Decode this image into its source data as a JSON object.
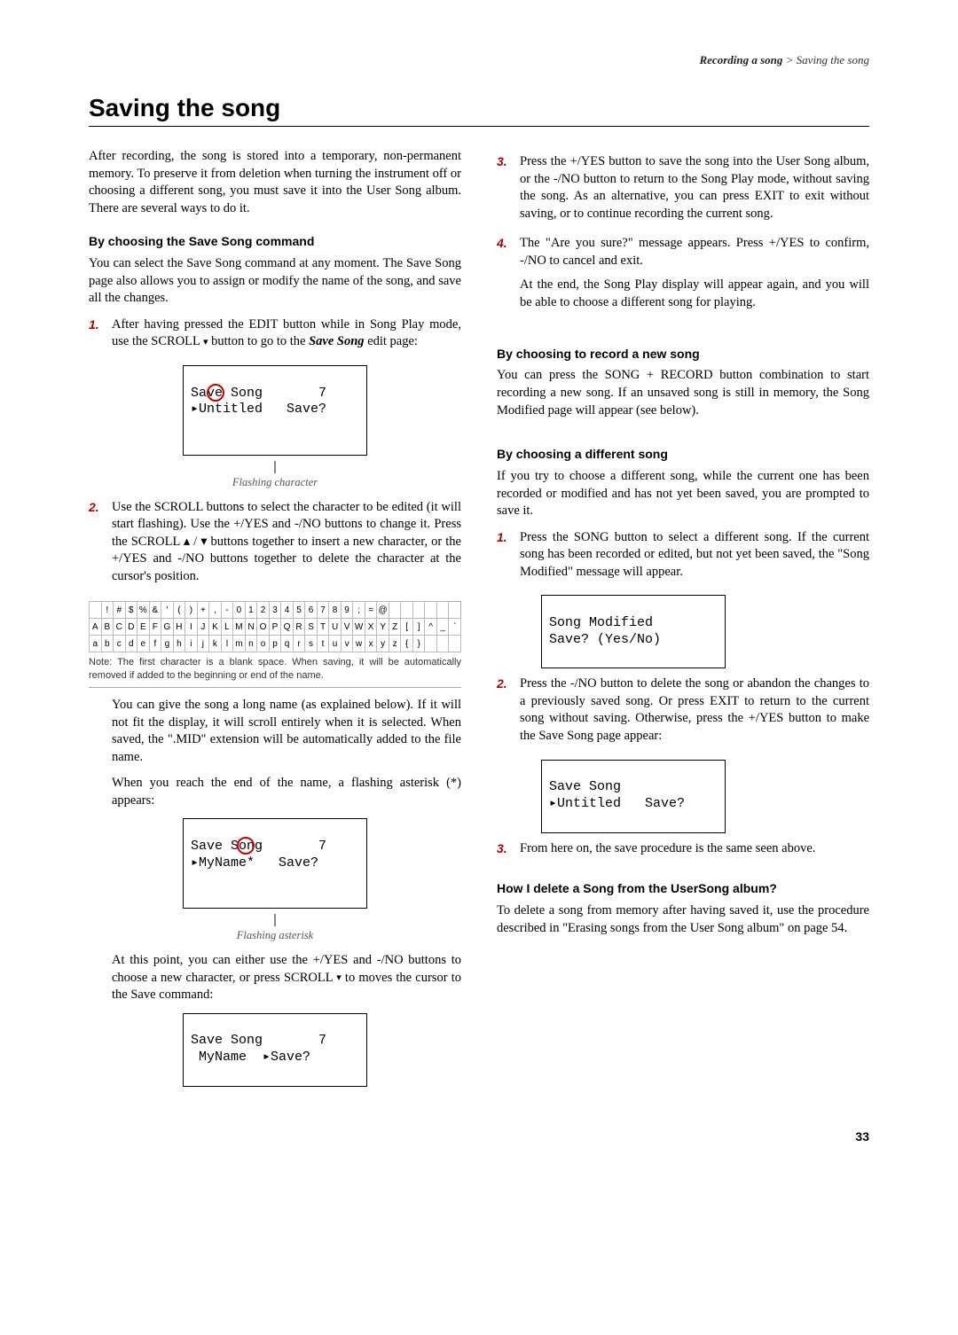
{
  "breadcrumb": {
    "section": "Recording a song",
    "page": "Saving the song"
  },
  "title": "Saving the song",
  "intro": "After recording, the song is stored into a temporary, non-permanent memory. To preserve it from deletion when turning the instrument off or choosing a different song, you must save it into the User Song album. There are several ways to do it.",
  "left": {
    "h_cmd": "By choosing the Save Song command",
    "cmd_p": "You can select the Save Song command at any moment. The Save Song page also allows you to assign or modify the name of the song, and save all the changes.",
    "s1a": "After having pressed the EDIT button while in Song Play mode, use the SCROLL ",
    "s1b": " button to go to the ",
    "s1c": "Save Song",
    "s1d": " edit page:",
    "lcd1_l1": "Save Song       7",
    "lcd1_l2": "▸Untitled   Save?",
    "caption1": "Flashing character",
    "s2": "Use the SCROLL buttons to select the character to be edited (it will start flashing). Use the +/YES and -/NO buttons to change it. Press the SCROLL ▴ / ▾ buttons together to insert a new character, or the +/YES and -/NO buttons together to delete the character at the cursor's position.",
    "char_row1": [
      " ",
      "!",
      "#",
      "$",
      "%",
      "&",
      "'",
      "(",
      ")",
      "+",
      ",",
      "-",
      "0",
      "1",
      "2",
      "3",
      "4",
      "5",
      "6",
      "7",
      "8",
      "9",
      ";",
      "=",
      "@",
      " ",
      " ",
      " ",
      " ",
      " "
    ],
    "char_row2": [
      "A",
      "B",
      "C",
      "D",
      "E",
      "F",
      "G",
      "H",
      "I",
      "J",
      "K",
      "L",
      "M",
      "N",
      "O",
      "P",
      "Q",
      "R",
      "S",
      "T",
      "U",
      "V",
      "W",
      "X",
      "Y",
      "Z",
      "[",
      "]",
      "^",
      "_",
      "`"
    ],
    "char_row3": [
      "a",
      "b",
      "c",
      "d",
      "e",
      "f",
      "g",
      "h",
      "i",
      "j",
      "k",
      "l",
      "m",
      "n",
      "o",
      "p",
      "q",
      "r",
      "s",
      "t",
      "u",
      "v",
      "w",
      "x",
      "y",
      "z",
      "{",
      "}",
      " ",
      " ",
      " "
    ],
    "char_note": "Note: The first character is a blank space. When saving, it will be automatically removed if added to the beginning or end of the name.",
    "p_longname": "You can give the song a long name (as explained below). If it will not fit the display, it will scroll entirely when it is selected. When saved, the \".MID\" extension will be automatically added to the file name.",
    "p_asterisk": "When you reach the end of the name, a flashing asterisk (*) appears:",
    "lcd2_l1": "Save Song       7",
    "lcd2_l2": "▸MyName*   Save?",
    "caption2": "Flashing asterisk",
    "p_after_ast_a": "At this point, you can either use the +/YES and -/NO buttons to choose a new character, or press SCROLL ",
    "p_after_ast_b": " to moves the cursor to the Save command:",
    "lcd3_l1": "Save Song       7",
    "lcd3_l2": " MyName  ▸Save?"
  },
  "right": {
    "s3": "Press the +/YES button to save the song into the User Song album, or the -/NO button to return to the Song Play mode, without saving the song. As an alternative, you can press EXIT to exit without saving, or to continue recording the current song.",
    "s4a": "The \"Are you sure?\" message appears. Press +/YES to confirm, -/NO to cancel and exit.",
    "s4b": "At the end, the Song Play display will appear again, and you will be able to choose a different song for playing.",
    "h_rec": "By choosing to record a new song",
    "rec_p": "You can press the SONG + RECORD button combination to start recording a new song. If an unsaved song is still in memory, the Song Modified page will appear (see below).",
    "h_diff": "By choosing a different song",
    "diff_p": "If you try to choose a different song, while the current one has been recorded or modified and has not yet been saved, you are prompted to save it.",
    "d1": "Press the SONG button to select a different song. If the current song has been recorded or edited, but not yet been saved, the \"Song Modified\" message will appear.",
    "lcd4_l1": "Song Modified",
    "lcd4_l2": "Save? (Yes/No)",
    "d2": "Press the -/NO button to delete the song or abandon the changes to a previously saved song. Or press EXIT to return to the current song without saving. Otherwise, press the +/YES button to make the Save Song page appear:",
    "lcd5_l1": "Save Song",
    "lcd5_l2": "▸Untitled   Save?",
    "d3": "From here on, the save procedure is the same seen above.",
    "h_del": "How I delete a Song from the UserSong album?",
    "del_p": "To delete a song from memory after having saved it, use the procedure described in \"Erasing songs from the User Song album\" on page 54."
  },
  "page_number": "33"
}
